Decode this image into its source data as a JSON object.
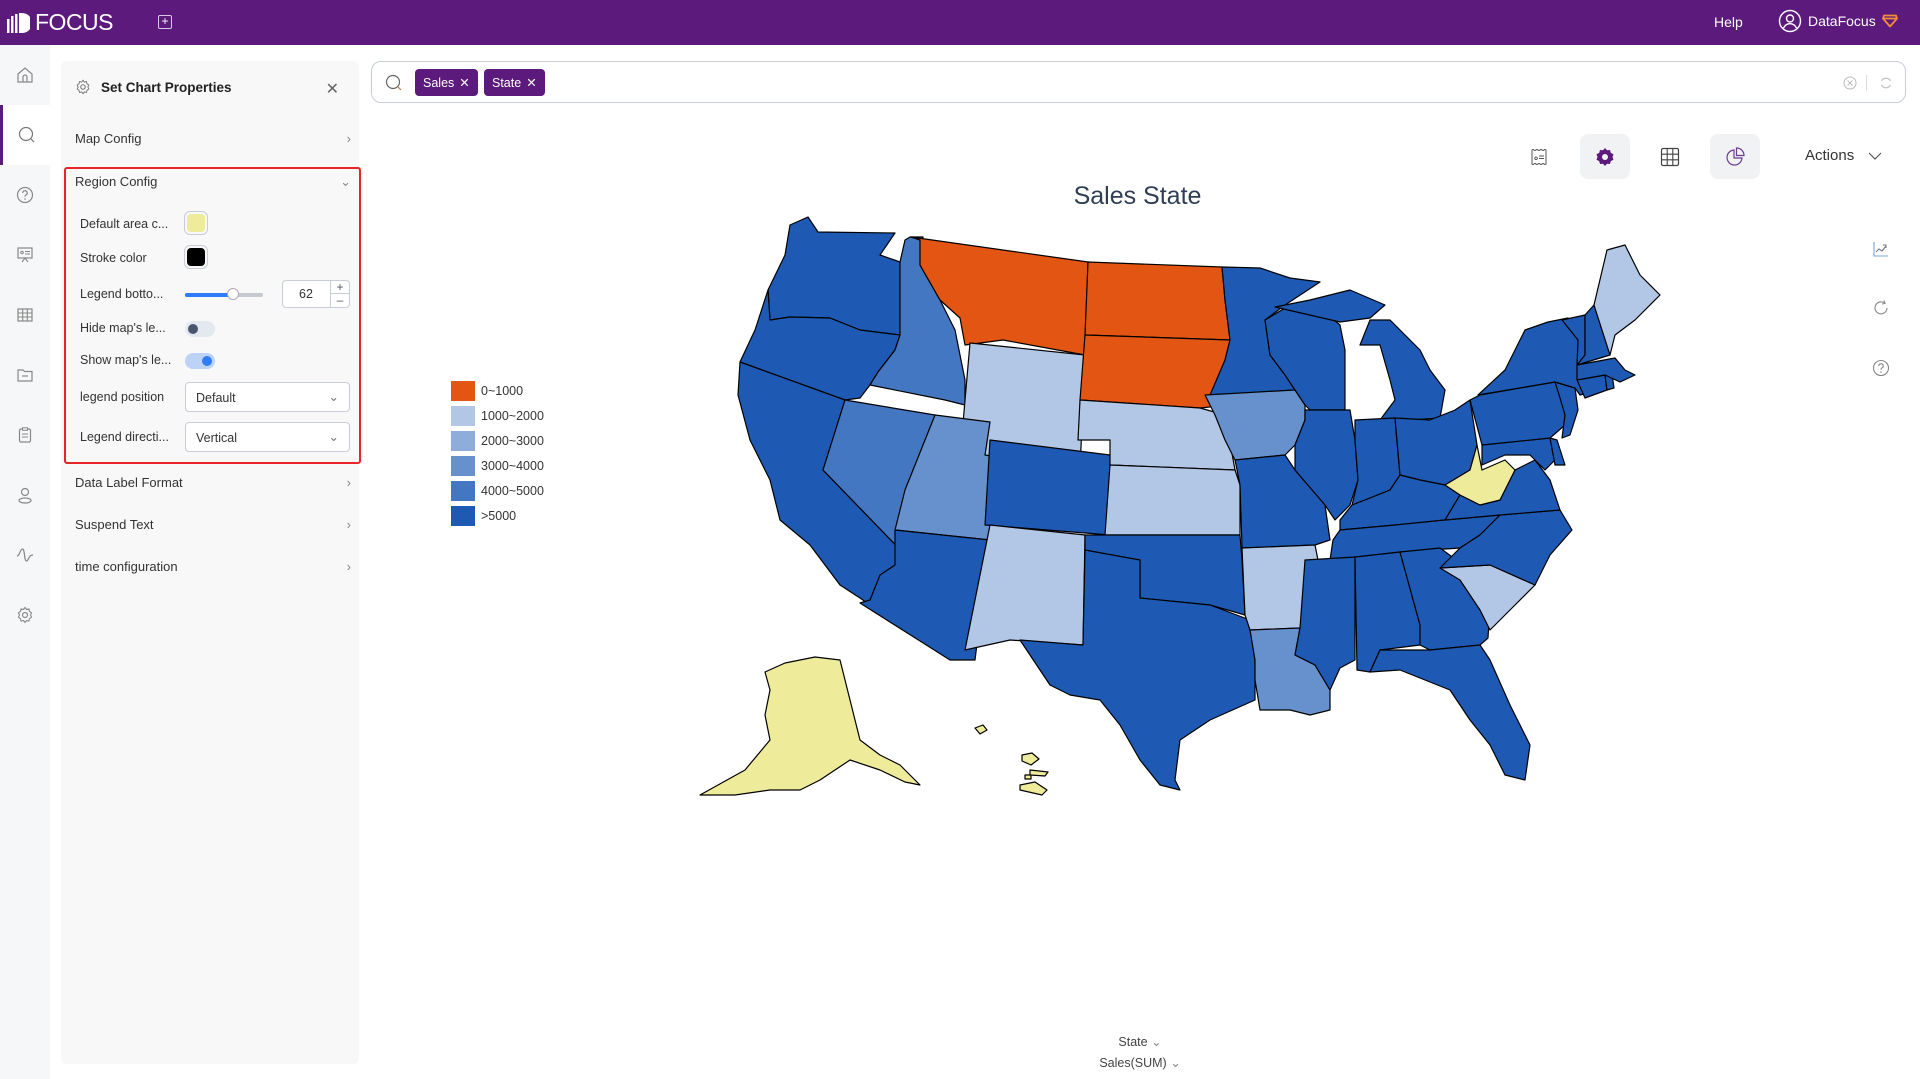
{
  "topbar": {
    "logo_text": "FOCUS",
    "help_label": "Help",
    "user_name": "DataFocus"
  },
  "sidenav": {
    "items": [
      {
        "name": "home",
        "icon": "home-icon"
      },
      {
        "name": "search",
        "icon": "search-icon",
        "active": true
      },
      {
        "name": "question",
        "icon": "question-icon"
      },
      {
        "name": "presentation",
        "icon": "presentation-icon"
      },
      {
        "name": "table",
        "icon": "table-icon"
      },
      {
        "name": "folder",
        "icon": "folder-icon"
      },
      {
        "name": "clipboard",
        "icon": "clipboard-icon"
      },
      {
        "name": "user",
        "icon": "user-icon"
      },
      {
        "name": "pulse",
        "icon": "pulse-icon"
      },
      {
        "name": "settings",
        "icon": "gear-icon"
      }
    ]
  },
  "panel": {
    "title": "Set Chart Properties",
    "sections": {
      "map_config": "Map Config",
      "region_config": "Region Config",
      "data_label_format": "Data Label Format",
      "suspend_text": "Suspend Text",
      "time_configuration": "time configuration"
    },
    "region": {
      "default_area_color_label": "Default area c...",
      "default_area_color": "#eeeb9b",
      "stroke_color_label": "Stroke color",
      "stroke_color": "#000000",
      "legend_bottom_label": "Legend botto...",
      "legend_bottom_value": "62",
      "legend_bottom_slider_fraction": 0.62,
      "hide_legend_label": "Hide map's le...",
      "hide_legend_on": false,
      "show_legend_label": "Show map's le...",
      "show_legend_on": true,
      "legend_position_label": "legend position",
      "legend_position_value": "Default",
      "legend_direction_label": "Legend directi...",
      "legend_direction_value": "Vertical"
    }
  },
  "search": {
    "chips": [
      {
        "label": "Sales"
      },
      {
        "label": "State"
      }
    ]
  },
  "toolbar": {
    "actions_label": "Actions"
  },
  "axis": {
    "dimension_label": "State",
    "measure_label": "Sales(SUM)"
  },
  "chart_data": {
    "type": "choropleth-map",
    "title": "Sales State",
    "region": "USA",
    "legend": {
      "placement": "left",
      "direction": "vertical",
      "bins": [
        {
          "label": "0~1000",
          "color": "#e35512"
        },
        {
          "label": "1000~2000",
          "color": "#b2c7e6"
        },
        {
          "label": "2000~3000",
          "color": "#8fadda"
        },
        {
          "label": "3000~4000",
          "color": "#6791cc"
        },
        {
          "label": "4000~5000",
          "color": "#4477c2"
        },
        {
          "label": ">5000",
          "color": "#1e5ab3"
        }
      ]
    },
    "default_color": "#eeeb9b",
    "states": [
      {
        "state": "Washington",
        "bin": ">5000"
      },
      {
        "state": "Oregon",
        "bin": ">5000"
      },
      {
        "state": "California",
        "bin": ">5000"
      },
      {
        "state": "Idaho",
        "bin": "4000~5000"
      },
      {
        "state": "Nevada",
        "bin": "4000~5000"
      },
      {
        "state": "Montana",
        "bin": "0~1000"
      },
      {
        "state": "Wyoming",
        "bin": "1000~2000"
      },
      {
        "state": "Utah",
        "bin": "3000~4000"
      },
      {
        "state": "Arizona",
        "bin": ">5000"
      },
      {
        "state": "Colorado",
        "bin": ">5000"
      },
      {
        "state": "New Mexico",
        "bin": "1000~2000"
      },
      {
        "state": "North Dakota",
        "bin": "0~1000"
      },
      {
        "state": "South Dakota",
        "bin": "0~1000"
      },
      {
        "state": "Nebraska",
        "bin": "1000~2000"
      },
      {
        "state": "Kansas",
        "bin": "1000~2000"
      },
      {
        "state": "Oklahoma",
        "bin": ">5000"
      },
      {
        "state": "Texas",
        "bin": ">5000"
      },
      {
        "state": "Minnesota",
        "bin": ">5000"
      },
      {
        "state": "Iowa",
        "bin": "3000~4000"
      },
      {
        "state": "Missouri",
        "bin": ">5000"
      },
      {
        "state": "Arkansas",
        "bin": "1000~2000"
      },
      {
        "state": "Louisiana",
        "bin": "3000~4000"
      },
      {
        "state": "Wisconsin",
        "bin": ">5000"
      },
      {
        "state": "Illinois",
        "bin": ">5000"
      },
      {
        "state": "Michigan",
        "bin": ">5000"
      },
      {
        "state": "Indiana",
        "bin": ">5000"
      },
      {
        "state": "Ohio",
        "bin": ">5000"
      },
      {
        "state": "Kentucky",
        "bin": ">5000"
      },
      {
        "state": "Tennessee",
        "bin": ">5000"
      },
      {
        "state": "Mississippi",
        "bin": ">5000"
      },
      {
        "state": "Alabama",
        "bin": ">5000"
      },
      {
        "state": "Georgia",
        "bin": ">5000"
      },
      {
        "state": "Florida",
        "bin": ">5000"
      },
      {
        "state": "South Carolina",
        "bin": "1000~2000"
      },
      {
        "state": "North Carolina",
        "bin": ">5000"
      },
      {
        "state": "Virginia",
        "bin": ">5000"
      },
      {
        "state": "West Virginia",
        "bin": "no data"
      },
      {
        "state": "Maryland",
        "bin": ">5000"
      },
      {
        "state": "Delaware",
        "bin": ">5000"
      },
      {
        "state": "Pennsylvania",
        "bin": ">5000"
      },
      {
        "state": "New Jersey",
        "bin": ">5000"
      },
      {
        "state": "New York",
        "bin": ">5000"
      },
      {
        "state": "Connecticut",
        "bin": ">5000"
      },
      {
        "state": "Rhode Island",
        "bin": ">5000"
      },
      {
        "state": "Massachusetts",
        "bin": ">5000"
      },
      {
        "state": "Vermont",
        "bin": ">5000"
      },
      {
        "state": "New Hampshire",
        "bin": ">5000"
      },
      {
        "state": "Maine",
        "bin": "1000~2000"
      },
      {
        "state": "Alaska",
        "bin": "no data"
      },
      {
        "state": "Hawaii",
        "bin": "no data"
      }
    ]
  }
}
